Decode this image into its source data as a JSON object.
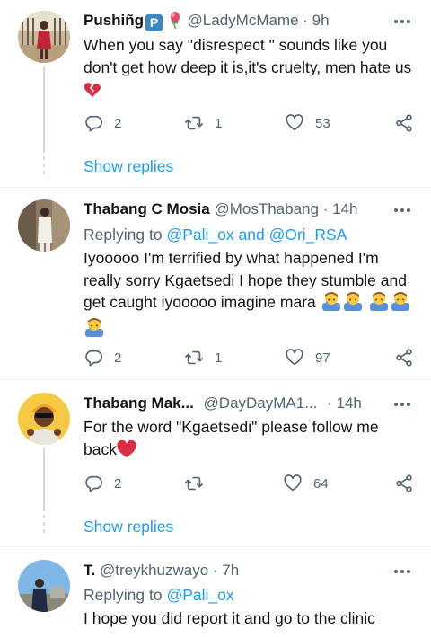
{
  "tweets": [
    {
      "name": "Pushiñg",
      "handle": "@LadyMcMame",
      "time": "· 9h",
      "text": "When you say \"disrespect \" sounds like you don't get how deep it is,it's cruelty, men hate us",
      "badge_letter": "P",
      "replies": "2",
      "retweets": "1",
      "likes": "53",
      "show_replies": "Show replies"
    },
    {
      "name": "Thabang C Mosia",
      "handle": "@MosThabang",
      "time": "· 14h",
      "replying_label": "Replying to",
      "replying_a": "@Pali_ox",
      "replying_and": "and",
      "replying_b": "@Ori_RSA",
      "text": "Iyooooo I'm terrified by what happened I'm really sorry Kgaetsedi I hope they stumble and get caught iyooooo imagine mara",
      "replies": "2",
      "retweets": "1",
      "likes": "97"
    },
    {
      "name": "Thabang Mak...",
      "handle": "@DayDayMA1...",
      "time": "· 14h",
      "text": "For the word \"Kgaetsedi\" please follow me back",
      "replies": "2",
      "retweets": "",
      "likes": "64",
      "show_replies": "Show replies"
    },
    {
      "name": "T.",
      "handle": "@treykhuzwayo",
      "time": "· 7h",
      "replying_label": "Replying to",
      "replying_a": "@Pali_ox",
      "text": "I hope you did report it and go to the clinic"
    }
  ],
  "icons": {
    "reply": "reply-icon",
    "retweet": "retweet-icon",
    "like": "heart-icon",
    "share": "share-icon",
    "more": "more-dots-icon"
  },
  "colors": {
    "accent": "#1d9bf0",
    "muted": "#536471",
    "text": "#0f1419",
    "heart": "#e0245e"
  }
}
